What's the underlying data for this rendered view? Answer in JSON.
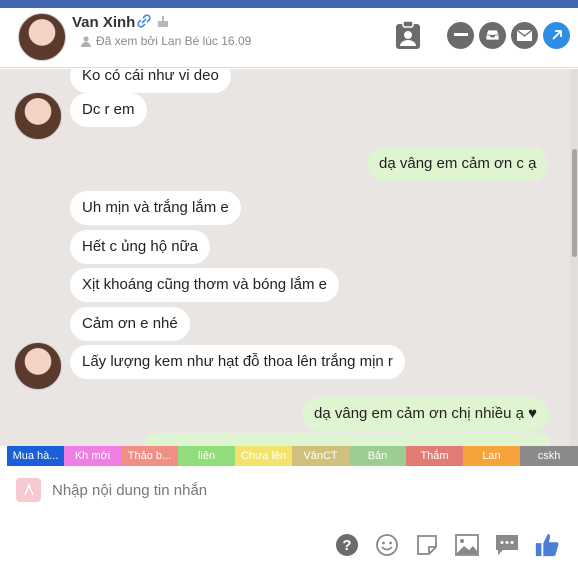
{
  "header": {
    "name": "Van Xinh",
    "seen_text": "Đã xem bởi Lan Bé lúc 16.09",
    "icons": [
      "clipboard-user-icon",
      "minimize-icon",
      "inbox-icon",
      "mail-icon",
      "open-external-icon"
    ]
  },
  "messages": [
    {
      "from": "them",
      "text": "Ko có cái như vi deo"
    },
    {
      "from": "them",
      "text": "Dc r em"
    },
    {
      "from": "me",
      "text": "dạ vâng em cảm ơn c ạ"
    },
    {
      "from": "them",
      "text": "Uh mịn và trắng lắm e"
    },
    {
      "from": "them",
      "text": "Hết c ủng hộ nữa"
    },
    {
      "from": "them",
      "text": "Xịt khoáng cũng thơm và bóng lắm e"
    },
    {
      "from": "them",
      "text": "Cảm ơn e nhé"
    },
    {
      "from": "them",
      "text": "Lấy lượng kem như hạt đỗ thoa lên trắng mịn r"
    },
    {
      "from": "me",
      "text": "dạ vâng em cảm ơn chị nhiều ạ ♥"
    }
  ],
  "tags": [
    {
      "label": "Mua hà...",
      "color": "#1a5fd6"
    },
    {
      "label": "Kh mới",
      "color": "#ef7fe3"
    },
    {
      "label": "Thảo b...",
      "color": "#f08f84"
    },
    {
      "label": "liên",
      "color": "#93dc7b"
    },
    {
      "label": "Chưa lên",
      "color": "#f1e36b"
    },
    {
      "label": "VânCT",
      "color": "#cfc07c"
    },
    {
      "label": "Bản",
      "color": "#9cce92"
    },
    {
      "label": "Thắm",
      "color": "#e17b73"
    },
    {
      "label": "Lan",
      "color": "#f5a33d"
    },
    {
      "label": "cskh",
      "color": "#8a8a8a"
    }
  ],
  "composer": {
    "placeholder": "Nhập nội dung tin nhắn",
    "tool_icons": [
      "help-icon",
      "emoji-icon",
      "sticker-icon",
      "image-icon",
      "chat-dots-icon",
      "like-icon"
    ]
  }
}
